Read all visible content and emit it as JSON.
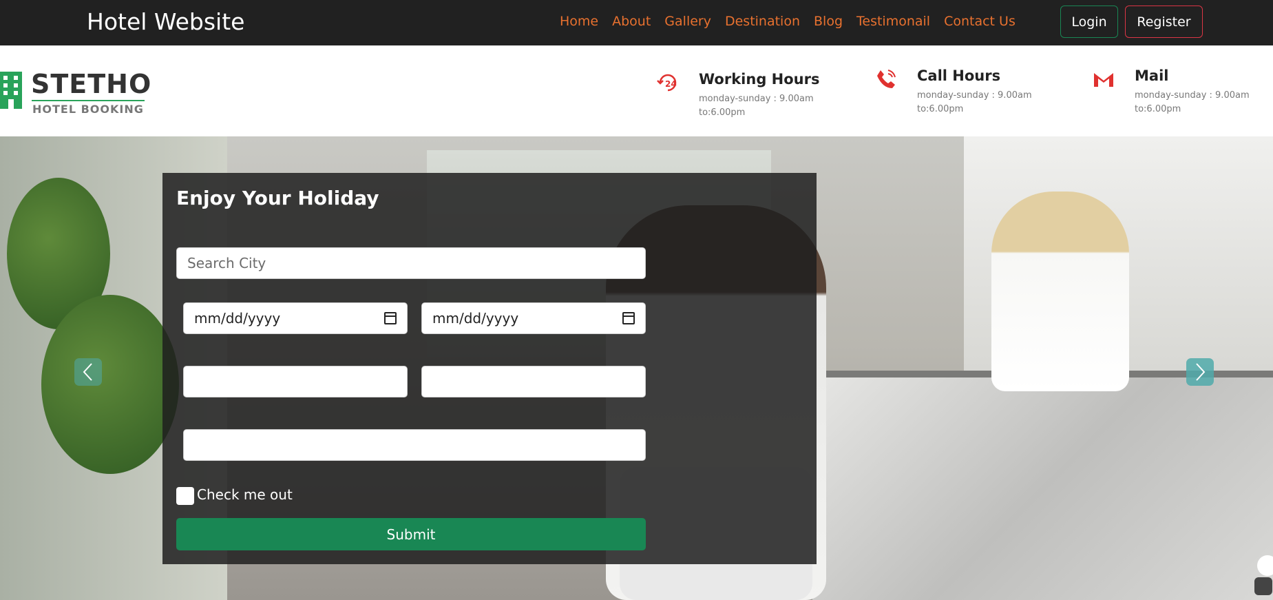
{
  "navbar": {
    "brand": "Hotel Website",
    "links": [
      "Home",
      "About",
      "Gallery",
      "Destination",
      "Blog",
      "Testimonail",
      "Contact Us"
    ],
    "login_label": "Login",
    "register_label": "Register"
  },
  "logo": {
    "title": "STETHO",
    "subtitle": "HOTEL BOOKING"
  },
  "info": [
    {
      "icon": "24-hours-icon",
      "title": "Working Hours",
      "text": "monday-sunday : 9.00am to:6.00pm"
    },
    {
      "icon": "phone-icon",
      "title": "Call Hours",
      "text": "monday-sunday : 9.00am to:6.00pm"
    },
    {
      "icon": "gmail-icon",
      "title": "Mail",
      "text": "monday-sunday : 9.00am to:6.00pm"
    }
  ],
  "form": {
    "title": "Enjoy Your Holiday",
    "search_placeholder": "Search City",
    "checkin_value": "mm/dd/yyyy",
    "checkout_value": "mm/dd/yyyy",
    "checkbox_label": "Check me out",
    "submit_label": "Submit"
  },
  "colors": {
    "navbar_bg": "#212121",
    "nav_link": "#e8712f",
    "accent_green": "#198754",
    "accent_red": "#dc3545",
    "icon_red": "#e0312f"
  }
}
